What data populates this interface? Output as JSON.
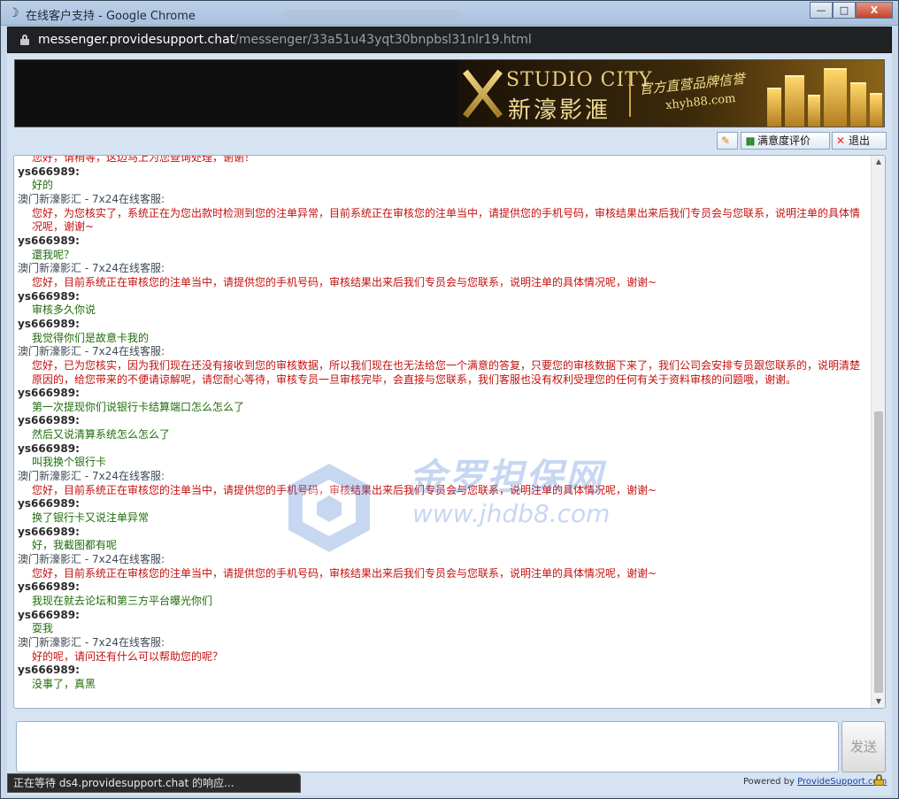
{
  "window": {
    "title": "在线客户支持 - Google Chrome",
    "controls": {
      "minimize": "—",
      "maximize": "□",
      "close": "X"
    }
  },
  "address": {
    "host": "messenger.providesupport.chat",
    "path": "/messenger/33a51u43yqt30bnpbsl31nlr19.html"
  },
  "banner": {
    "brand_en": "STUDIO CITY",
    "brand_cn": "新濠影滙",
    "slogan": "官方直营品牌信誉",
    "url": "xhyh88.com"
  },
  "toolbar": {
    "rate_label": "满意度评价",
    "exit_label": "退出"
  },
  "chat": {
    "messages": [
      {
        "kind": "at",
        "text": "您好，请稍等，这边马上为您查询处理，谢谢！"
      },
      {
        "kind": "u",
        "text": "ys666989:"
      },
      {
        "kind": "ut",
        "text": "好的"
      },
      {
        "kind": "a",
        "text": "澳门新濠影汇 - 7x24在线客服:"
      },
      {
        "kind": "at",
        "text": "您好，为您核实了，系统正在为您出款时检测到您的注单异常，目前系统正在审核您的注单当中，请提供您的手机号码，审核结果出来后我们专员会与您联系，说明注单的具体情况呢，谢谢~"
      },
      {
        "kind": "u",
        "text": "ys666989:"
      },
      {
        "kind": "ut",
        "text": "還我呢？"
      },
      {
        "kind": "a",
        "text": "澳门新濠影汇 - 7x24在线客服:"
      },
      {
        "kind": "at",
        "text": "您好，目前系统正在审核您的注单当中，请提供您的手机号码，审核结果出来后我们专员会与您联系，说明注单的具体情况呢，谢谢~"
      },
      {
        "kind": "u",
        "text": "ys666989:"
      },
      {
        "kind": "ut",
        "text": "审核多久你说"
      },
      {
        "kind": "u",
        "text": "ys666989:"
      },
      {
        "kind": "ut",
        "text": "我觉得你们是故意卡我的"
      },
      {
        "kind": "a",
        "text": "澳门新濠影汇 - 7x24在线客服:"
      },
      {
        "kind": "at",
        "text": "您好，已为您核实，因为我们现在还没有接收到您的审核数据，所以我们现在也无法给您一个满意的答复，只要您的审核数据下来了，我们公司会安排专员跟您联系的，说明清楚原因的，给您带来的不便请谅解呢，请您耐心等待，审核专员一旦审核完毕，会直接与您联系，我们客服也没有权利受理您的任何有关于资料审核的问题哦，谢谢。"
      },
      {
        "kind": "u",
        "text": "ys666989:"
      },
      {
        "kind": "ut",
        "text": "第一次提现你们说银行卡结算端口怎么怎么了"
      },
      {
        "kind": "u",
        "text": "ys666989:"
      },
      {
        "kind": "ut",
        "text": "然后又说清算系统怎么怎么了"
      },
      {
        "kind": "u",
        "text": "ys666989:"
      },
      {
        "kind": "ut",
        "text": "叫我换个银行卡"
      },
      {
        "kind": "a",
        "text": "澳门新濠影汇 - 7x24在线客服:"
      },
      {
        "kind": "at",
        "text": "您好，目前系统正在审核您的注单当中，请提供您的手机号码，审核结果出来后我们专员会与您联系，说明注单的具体情况呢，谢谢~"
      },
      {
        "kind": "u",
        "text": "ys666989:"
      },
      {
        "kind": "ut",
        "text": "换了银行卡又说注单异常"
      },
      {
        "kind": "u",
        "text": "ys666989:"
      },
      {
        "kind": "ut",
        "text": "好，我截图都有呢"
      },
      {
        "kind": "a",
        "text": "澳门新濠影汇 - 7x24在线客服:"
      },
      {
        "kind": "at",
        "text": "您好，目前系统正在审核您的注单当中，请提供您的手机号码，审核结果出来后我们专员会与您联系，说明注单的具体情况呢，谢谢~"
      },
      {
        "kind": "u",
        "text": "ys666989:"
      },
      {
        "kind": "ut",
        "text": "我现在就去论坛和第三方平台曝光你们"
      },
      {
        "kind": "u",
        "text": "ys666989:"
      },
      {
        "kind": "ut",
        "text": "耍我"
      },
      {
        "kind": "a",
        "text": "澳门新濠影汇 - 7x24在线客服:"
      },
      {
        "kind": "at",
        "text": "好的呢，请问还有什么可以帮助您的呢？"
      },
      {
        "kind": "u",
        "text": "ys666989:"
      },
      {
        "kind": "ut",
        "text": "没事了，真黑"
      }
    ]
  },
  "watermark": {
    "cn": "金罗担保网",
    "en": "www.jhdb8.com"
  },
  "compose": {
    "send_label": "发送"
  },
  "footer": {
    "powered_prefix": "Powered by",
    "powered_link": "ProvideSupport.com"
  },
  "status": {
    "text": "正在等待 ds4.providesupport.chat 的响应..."
  },
  "icons": {
    "app": "chrome-moon-icon",
    "lock": "lock-icon",
    "tool": "tool-icon",
    "rate": "chart-icon",
    "exit": "close-x-icon"
  },
  "colors": {
    "agent_text": "#c2100e",
    "user_text": "#1f6d0a",
    "address_bg": "#202124",
    "watermark": "#3a72d2"
  }
}
